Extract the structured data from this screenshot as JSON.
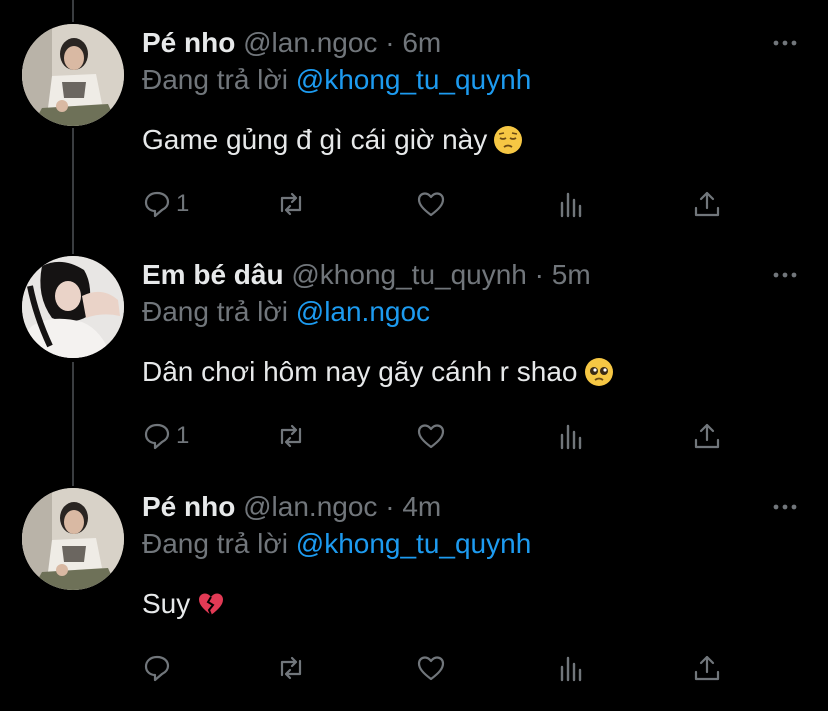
{
  "tweets": [
    {
      "display_name": "Pé nho",
      "handle": "@lan.ngoc",
      "separator": "·",
      "time": "6m",
      "replying_prefix": "Đang trả lời",
      "replying_to": "@khong_tu_quynh",
      "text": "Game gủng đ gì cái giờ này",
      "emoji": "pensive-face",
      "reply_count": "1"
    },
    {
      "display_name": "Em bé dâu",
      "handle": "@khong_tu_quynh",
      "separator": "·",
      "time": "5m",
      "replying_prefix": "Đang trả lời",
      "replying_to": "@lan.ngoc",
      "text": "Dân chơi hôm nay gãy cánh r shao",
      "emoji": "pleading-face",
      "reply_count": "1"
    },
    {
      "display_name": "Pé nho",
      "handle": "@lan.ngoc",
      "separator": "·",
      "time": "4m",
      "replying_prefix": "Đang trả lời",
      "replying_to": "@khong_tu_quynh",
      "text": "Suy",
      "emoji": "broken-heart",
      "reply_count": ""
    }
  ],
  "colors": {
    "background": "#000000",
    "primary_text": "#e7e9ea",
    "secondary_text": "#71767b",
    "mention": "#1d9bf0",
    "thread_line": "#3a3d40"
  },
  "icons": [
    "more-icon",
    "reply-icon",
    "retweet-icon",
    "like-icon",
    "views-icon",
    "share-icon"
  ]
}
